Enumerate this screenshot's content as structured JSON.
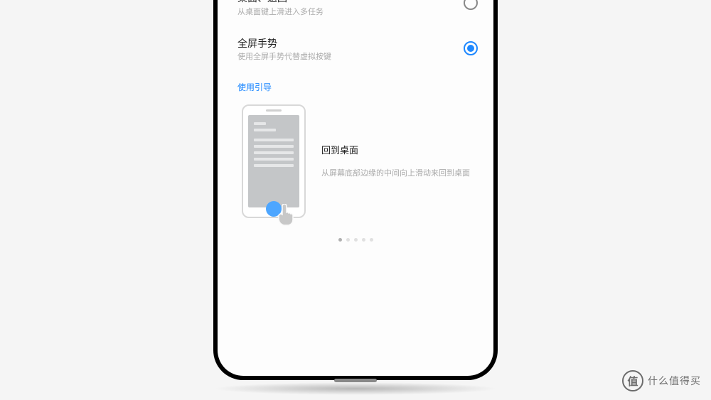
{
  "options": [
    {
      "title": "桌面、返回",
      "desc": "从桌面键上滑进入多任务",
      "selected": false
    },
    {
      "title": "全屏手势",
      "desc": "使用全屏手势代替虚拟按键",
      "selected": true
    }
  ],
  "guideLink": "使用引导",
  "tutorial": {
    "title": "回到桌面",
    "desc": "从屏幕底部边缘的中间向上滑动来回到桌面"
  },
  "pagination": {
    "total": 5,
    "active": 0
  },
  "watermark": {
    "icon": "值",
    "text": "什么值得买"
  }
}
